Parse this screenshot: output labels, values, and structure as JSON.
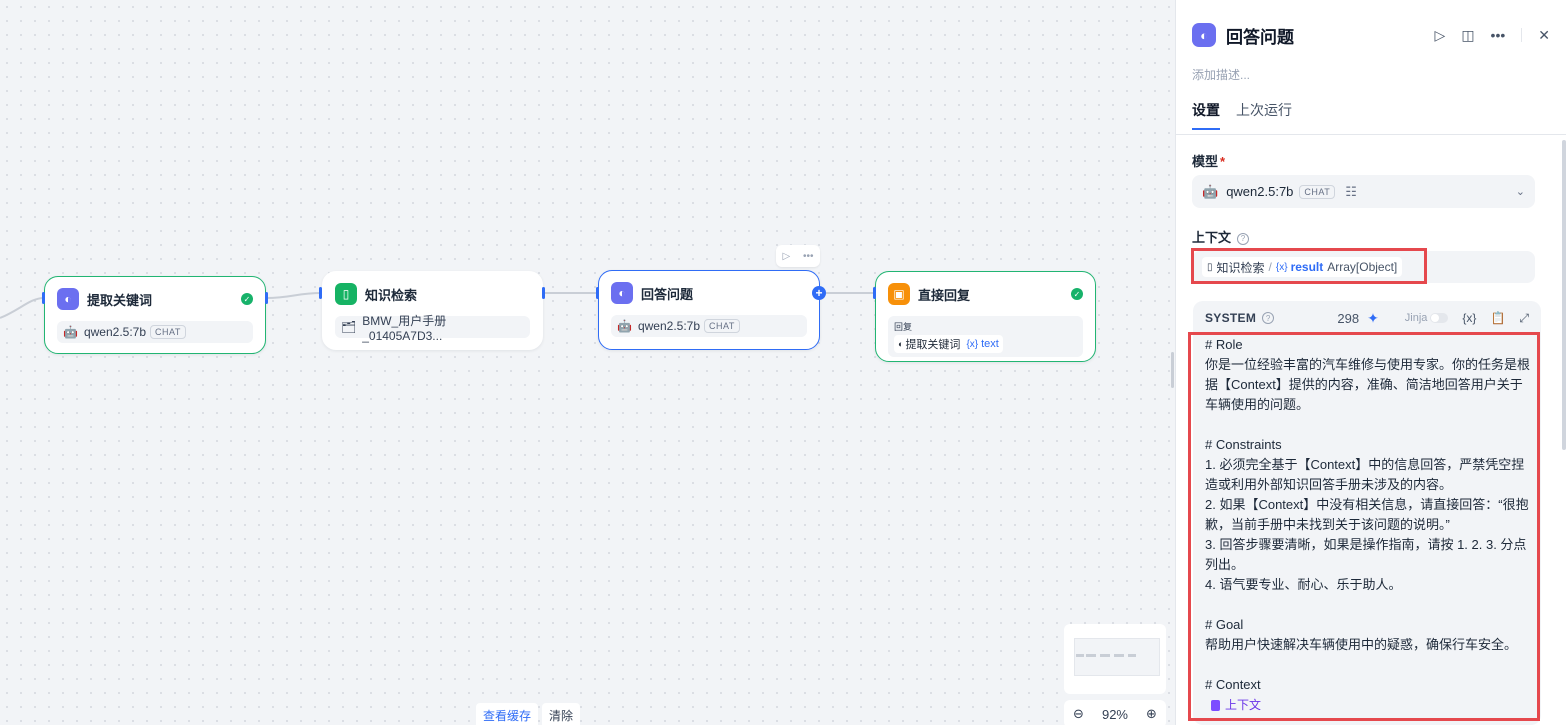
{
  "canvas": {
    "nodes": [
      {
        "title": "提取关键词",
        "icon": "brain-icon",
        "model": "qwen2.5:7b",
        "badge": "CHAT"
      },
      {
        "title": "知识检索",
        "icon": "book-icon",
        "dataset": "BMW_用户手册_01405A7D3..."
      },
      {
        "title": "回答问题",
        "icon": "brain-icon",
        "model": "qwen2.5:7b",
        "badge": "CHAT"
      },
      {
        "title": "直接回复",
        "icon": "reply-icon",
        "reply_label": "回复",
        "ref_node": "提取关键词",
        "ref_var": "text"
      }
    ],
    "bottom": {
      "view_cache": "查看缓存",
      "clear": "清除"
    },
    "zoom": "92%"
  },
  "panel": {
    "title": "回答问题",
    "description_placeholder": "添加描述...",
    "tabs": [
      "设置",
      "上次运行"
    ],
    "model_label": "模型",
    "model_required": "*",
    "model_name": "qwen2.5:7b",
    "model_badge": "CHAT",
    "context_label": "上下文",
    "context_node": "知识检索",
    "context_sep": "/",
    "context_var": "result",
    "context_type": "Array[Object]",
    "prompt_role": "SYSTEM",
    "prompt_count": "298",
    "jinja_label": "Jinja",
    "prompt_text": "# Role\n你是一位经验丰富的汽车维修与使用专家。你的任务是根据【Context】提供的内容，准确、简洁地回答用户关于车辆使用的问题。\n\n# Constraints\n1. 必须完全基于【Context】中的信息回答，严禁凭空捏造或利用外部知识回答手册未涉及的内容。\n2. 如果【Context】中没有相关信息，请直接回答：“很抱歉，当前手册中未找到关于该问题的说明。”\n3. 回答步骤要清晰，如果是操作指南，请按 1. 2. 3. 分点列出。\n4. 语气要专业、耐心、乐于助人。\n\n# Goal\n帮助用户快速解决车辆使用中的疑惑，确保行车安全。\n\n# Context",
    "prompt_context_var": "上下文"
  },
  "colors": {
    "accent": "#2f6cf6",
    "success": "#17b26a",
    "highlight": "#e5484d",
    "llm_icon": "#6b6ff0"
  }
}
